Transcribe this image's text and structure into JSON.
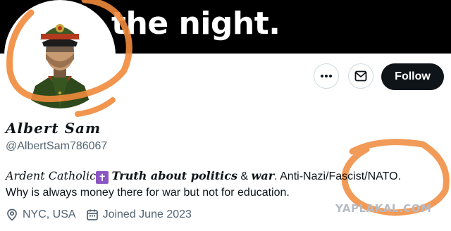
{
  "banner": {
    "text": "the night."
  },
  "profile": {
    "display_name": "Albert Sam",
    "handle": "@AlbertSam786067",
    "bio": {
      "part1": "Ardent Catholic",
      "cross": "✝",
      "part2": "Truth about politics",
      "part3": " & ",
      "part4": "war",
      "part5": ". Anti-Nazi/Fascist/NATO.",
      "line2": "Why is always money there for war but not for education."
    },
    "location": "NYC, USA",
    "joined": "Joined June 2023"
  },
  "actions": {
    "follow_label": "Follow"
  },
  "watermark": "YAPLAKAL.COM",
  "colors": {
    "follow_bg": "#0f1419",
    "scribble": "#f08a3c",
    "muted_text": "#536471"
  }
}
